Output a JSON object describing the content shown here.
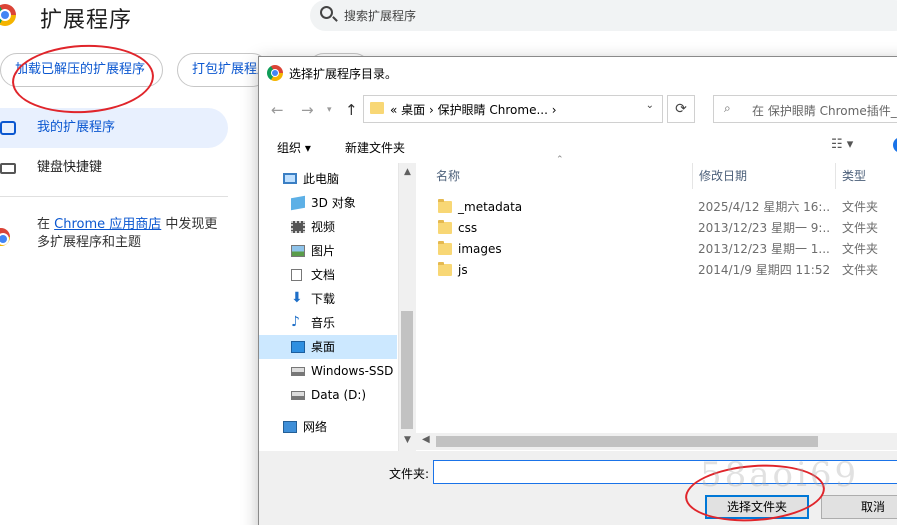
{
  "header": {
    "title": "扩展程序",
    "search_placeholder": "搜索扩展程序"
  },
  "actions": {
    "load_unpacked": "加载已解压的扩展程序",
    "pack_extension": "打包扩展程序"
  },
  "sidebar": {
    "items": [
      {
        "label": "我的扩展程序",
        "icon": "puzzle-icon"
      },
      {
        "label": "键盘快捷键",
        "icon": "keyboard-icon"
      }
    ],
    "webstore_prefix": "在 ",
    "webstore_link": "Chrome 应用商店",
    "webstore_suffix": " 中发现更多扩展程序和主题"
  },
  "dialog": {
    "title": "选择扩展程序目录。",
    "address": "« 桌面 › 保护眼睛 Chrome... ›",
    "search_placeholder": "在 保护眼睛 Chrome插件_",
    "toolbar": {
      "organize": "组织 ▾",
      "new_folder": "新建文件夹",
      "view": "☷ ▾",
      "help": "?"
    },
    "nav_tree": [
      {
        "label": "此电脑",
        "icon": "computer-icon"
      },
      {
        "label": "3D 对象",
        "icon": "cube-icon"
      },
      {
        "label": "视频",
        "icon": "video-icon"
      },
      {
        "label": "图片",
        "icon": "picture-icon"
      },
      {
        "label": "文档",
        "icon": "document-icon"
      },
      {
        "label": "下载",
        "icon": "download-icon"
      },
      {
        "label": "音乐",
        "icon": "music-icon"
      },
      {
        "label": "桌面",
        "icon": "desktop-icon",
        "selected": true
      },
      {
        "label": "Windows-SSD",
        "icon": "drive-icon"
      },
      {
        "label": "Data (D:)",
        "icon": "drive-icon"
      },
      {
        "label": "网络",
        "icon": "network-icon"
      }
    ],
    "columns": {
      "name": "名称",
      "date": "修改日期",
      "type": "类型"
    },
    "files": [
      {
        "name": "_metadata",
        "date": "2025/4/12 星期六 16:...",
        "type": "文件夹"
      },
      {
        "name": "css",
        "date": "2013/12/23 星期一 9:...",
        "type": "文件夹"
      },
      {
        "name": "images",
        "date": "2013/12/23 星期一 1...",
        "type": "文件夹"
      },
      {
        "name": "js",
        "date": "2014/1/9 星期四 11:52",
        "type": "文件夹"
      }
    ],
    "folder_label": "文件夹:",
    "folder_value": "",
    "select_button": "选择文件夹",
    "cancel_button": "取消"
  },
  "watermark": "58aoi69",
  "colors": {
    "accent": "#0b57d0",
    "annotation": "#e0252b",
    "selection": "#cce8ff",
    "folder": "#f8d775"
  }
}
